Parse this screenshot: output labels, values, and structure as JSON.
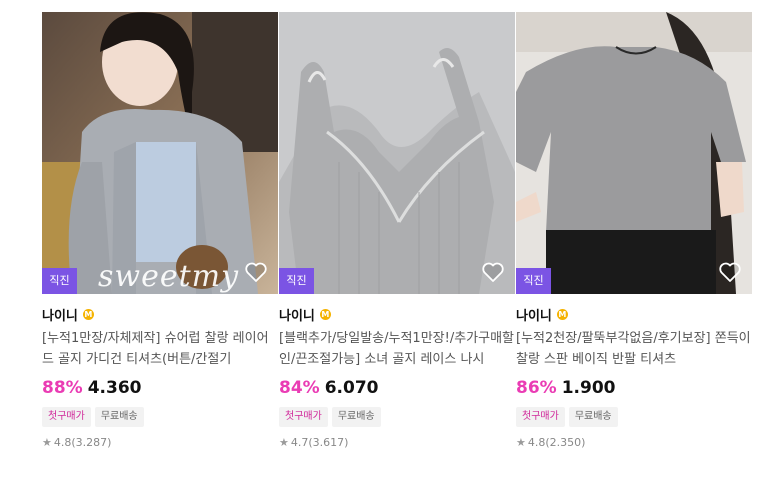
{
  "products": [
    {
      "badge": "직진",
      "watermark": "sweetmy",
      "shop": "나이니",
      "shop_badge": "M",
      "title": "[누적1만장/자체제작] 슈어럽 찰랑 레이어드 골지 가디건 티셔츠(버튼/간절기",
      "discount": "88%",
      "price": "4.360",
      "tags": [
        "첫구매가",
        "무료배송"
      ],
      "rating": "4.8",
      "reviews": "(3.287)"
    },
    {
      "badge": "직진",
      "shop": "나이니",
      "shop_badge": "M",
      "title": "[블랙추가/당일발송/누적1만장!/추가구매할인/끈조절가능] 소녀 골지 레이스 나시",
      "discount": "84%",
      "price": "6.070",
      "tags": [
        "첫구매가",
        "무료배송"
      ],
      "rating": "4.7",
      "reviews": "(3.617)"
    },
    {
      "badge": "직진",
      "shop": "나이니",
      "shop_badge": "M",
      "title": "[누적2천장/팔뚝부각없음/후기보장] 쫀득이 찰랑 스판 베이직 반팔 티셔츠",
      "discount": "86%",
      "price": "1.900",
      "tags": [
        "첫구매가",
        "무료배송"
      ],
      "rating": "4.8",
      "reviews": "(2.350)"
    }
  ],
  "colors": {
    "discount": "#ea3cb4",
    "badge": "#7b54e4",
    "first_tag": "#d0289a"
  },
  "icons": {
    "heart": "heart-icon",
    "star": "star-icon",
    "membership": "membership-m-icon"
  }
}
